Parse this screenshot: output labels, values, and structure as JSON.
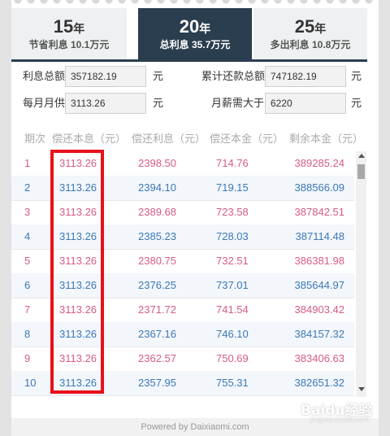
{
  "tabs": [
    {
      "years": "15",
      "unit": "年",
      "sub": "节省利息 10.1万元",
      "active": false
    },
    {
      "years": "20",
      "unit": "年",
      "sub": "总利息 35.7万元",
      "active": true
    },
    {
      "years": "25",
      "unit": "年",
      "sub": "多出利息 10.8万元",
      "active": false
    }
  ],
  "form": {
    "total_interest_label": "利息总额",
    "total_interest_value": "357182.19",
    "total_interest_unit": "元",
    "total_repayment_label": "累计还款总额",
    "total_repayment_value": "747182.19",
    "total_repayment_unit": "元",
    "monthly_label": "每月月供",
    "monthly_value": "3113.26",
    "monthly_unit": "元",
    "salary_label": "月薪需大于",
    "salary_value": "6220",
    "salary_unit": "元"
  },
  "table": {
    "headers": [
      "期次",
      "偿还本息（元）",
      "偿还利息（元）",
      "偿还本金（元）",
      "剩余本金（元）"
    ],
    "rows": [
      [
        "1",
        "3113.26",
        "2398.50",
        "714.76",
        "389285.24"
      ],
      [
        "2",
        "3113.26",
        "2394.10",
        "719.15",
        "388566.09"
      ],
      [
        "3",
        "3113.26",
        "2389.68",
        "723.58",
        "387842.51"
      ],
      [
        "4",
        "3113.26",
        "2385.23",
        "728.03",
        "387114.48"
      ],
      [
        "5",
        "3113.26",
        "2380.75",
        "732.51",
        "386381.98"
      ],
      [
        "6",
        "3113.26",
        "2376.25",
        "737.01",
        "385644.97"
      ],
      [
        "7",
        "3113.26",
        "2371.72",
        "741.54",
        "384903.42"
      ],
      [
        "8",
        "3113.26",
        "2367.16",
        "746.10",
        "384157.32"
      ],
      [
        "9",
        "3113.26",
        "2362.57",
        "750.69",
        "383406.63"
      ],
      [
        "10",
        "3113.26",
        "2357.95",
        "755.31",
        "382651.32"
      ]
    ]
  },
  "footer": {
    "text": "Powered by Daixiaomi.com"
  },
  "watermark": {
    "text": "Baidu经验",
    "sub": "jingyan.baidu.com"
  },
  "colors": {
    "accent": "#2b3e50",
    "pink": "#d65a88",
    "blue": "#3a79b8",
    "highlight": "#e8101a"
  }
}
